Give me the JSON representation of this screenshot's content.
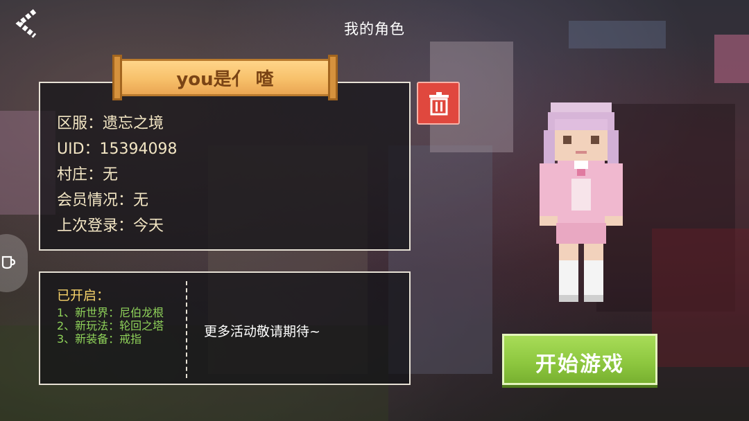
{
  "header": {
    "title": "我的角色",
    "back_icon": "chevron-left-icon"
  },
  "profile": {
    "nickname": "you是亻 喳",
    "lines": [
      "区服：遗忘之境",
      "UID：15394098",
      "村庄：无",
      "会员情况：无",
      "上次登录：今天"
    ]
  },
  "delete": {
    "icon": "trash-icon",
    "color": "#e0483e"
  },
  "events": {
    "open_title": "已开启：",
    "items": [
      "1、新世界：尼伯龙根",
      "2、新玩法：轮回之塔",
      "3、新装备：戒指"
    ],
    "more_text": "更多活动敬请期待~"
  },
  "start_button": {
    "label": "开始游戏",
    "color": "#8cc63e"
  },
  "side_handle": {
    "icon": "cup-icon"
  }
}
